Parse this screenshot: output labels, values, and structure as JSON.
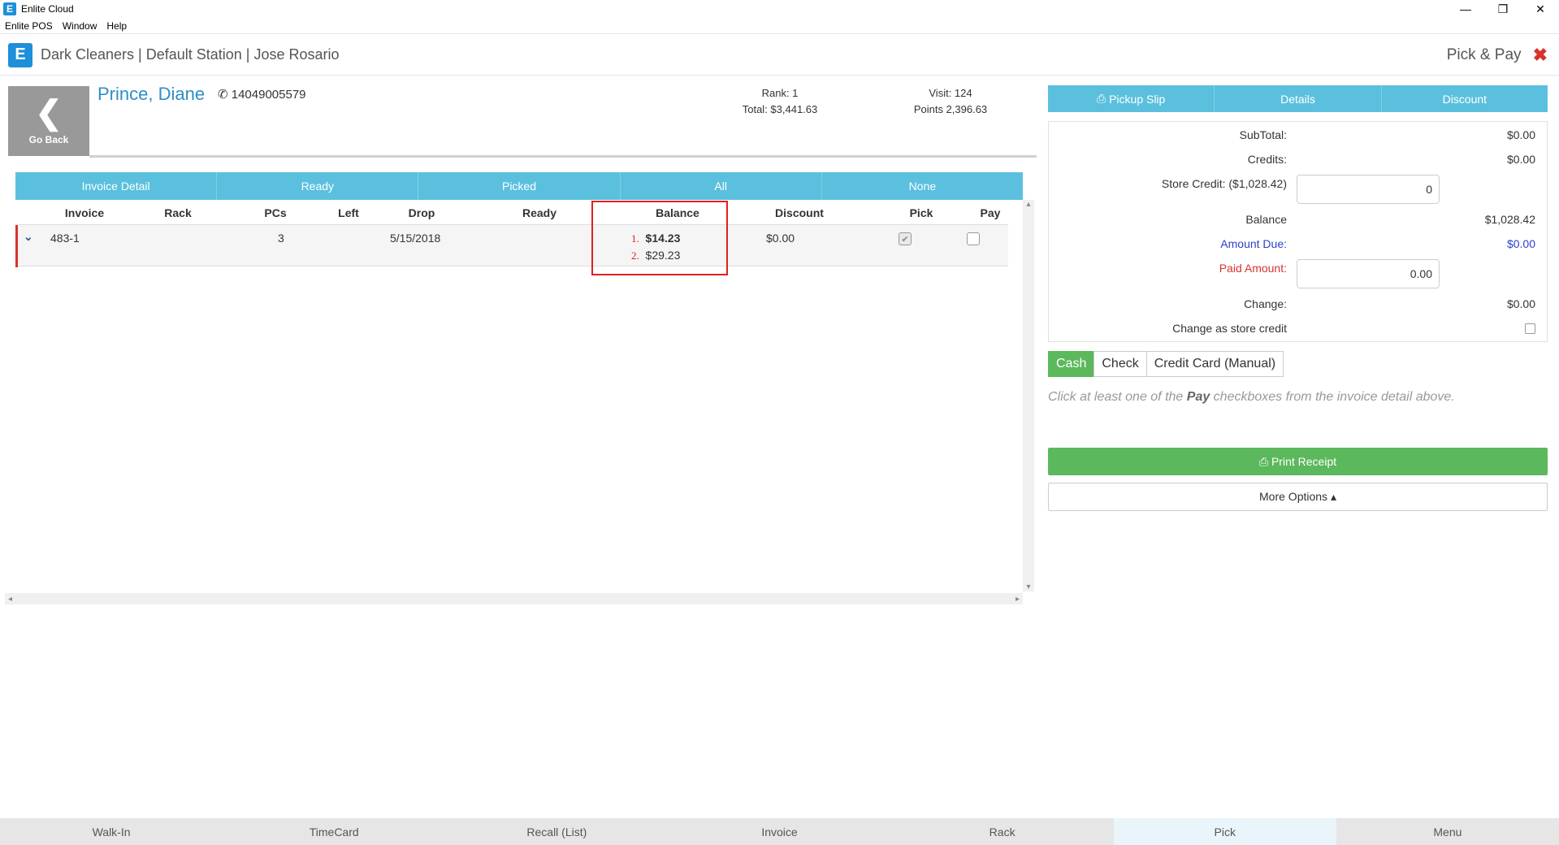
{
  "window": {
    "title": "Enlite Cloud",
    "logo_letter": "E",
    "controls": {
      "minimize": "—",
      "restore": "❐",
      "close": "✕"
    }
  },
  "menubar": [
    "Enlite POS",
    "Window",
    "Help"
  ],
  "header": {
    "title": "Dark Cleaners | Default Station | Jose Rosario",
    "page_label": "Pick & Pay",
    "close_glyph": "✖"
  },
  "customer": {
    "go_back_label": "Go Back",
    "name": "Prince, Diane",
    "phone": "14049005579",
    "rank": "Rank: 1",
    "total": "Total: $3,441.63",
    "visit": "Visit: 124",
    "points": "Points 2,396.63"
  },
  "filters": [
    "Invoice Detail",
    "Ready",
    "Picked",
    "All",
    "None"
  ],
  "table": {
    "headers": [
      "Invoice",
      "Rack",
      "PCs",
      "Left",
      "Drop",
      "Ready",
      "Balance",
      "Discount",
      "Pick",
      "Pay"
    ],
    "rows": [
      {
        "invoice": "483-1",
        "rack": "",
        "pcs": "3",
        "left": "",
        "drop": "5/15/2018",
        "ready": "",
        "balance_1": "$14.23",
        "balance_2": "$29.23",
        "discount": "$0.00",
        "pick": true,
        "pay": false
      }
    ],
    "annotation_labels": [
      "1.",
      "2."
    ]
  },
  "right_panel": {
    "tabs": [
      "Pickup Slip",
      "Details",
      "Discount"
    ],
    "summary": {
      "subtotal_label": "SubTotal:",
      "subtotal_value": "$0.00",
      "credits_label": "Credits:",
      "credits_value": "$0.00",
      "store_credit_label": "Store Credit: ($1,028.42)",
      "store_credit_input": "0",
      "balance_label": "Balance",
      "balance_value": "$1,028.42",
      "amount_due_label": "Amount Due:",
      "amount_due_value": "$0.00",
      "paid_amount_label": "Paid Amount:",
      "paid_amount_input": "0.00",
      "change_label": "Change:",
      "change_value": "$0.00",
      "change_store_credit_label": "Change as store credit"
    },
    "pay_methods": [
      "Cash",
      "Check",
      "Credit Card (Manual)"
    ],
    "pay_message_pre": "Click at least one of the ",
    "pay_message_bold": "Pay",
    "pay_message_post": " checkboxes from the invoice detail above.",
    "print_receipt_label": "Print Receipt",
    "more_options_label": "More Options ▴"
  },
  "bottom_nav": [
    "Walk-In",
    "TimeCard",
    "Recall (List)",
    "Invoice",
    "Rack",
    "Pick",
    "Menu"
  ],
  "colors": {
    "accent": "#5bc0de",
    "success": "#5cb85c",
    "danger": "#d9322e",
    "link": "#2e8ec7"
  }
}
